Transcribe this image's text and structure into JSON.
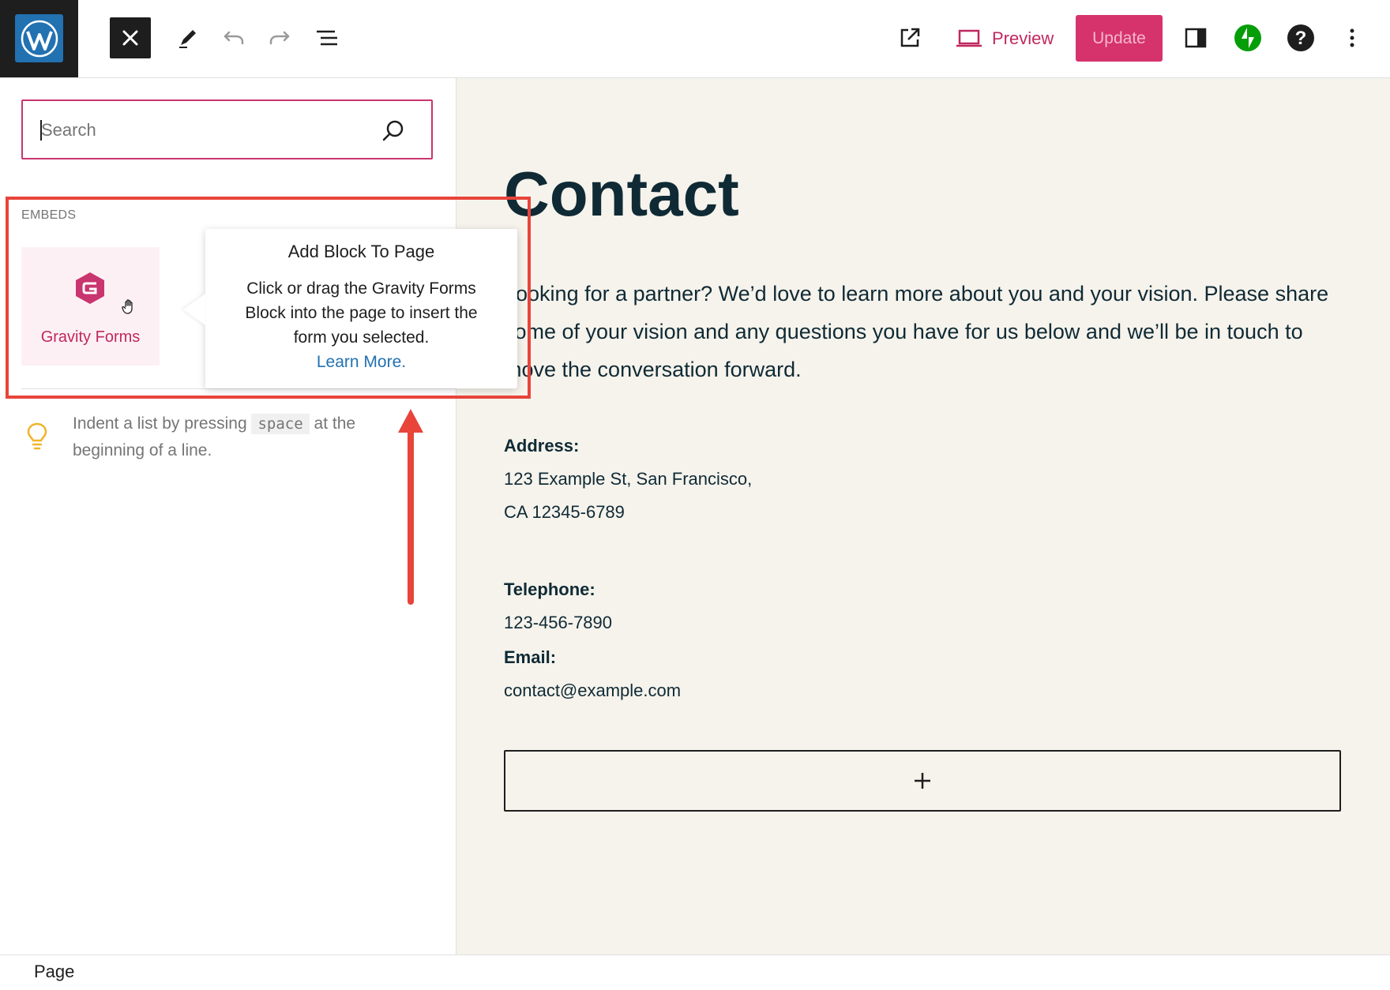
{
  "toolbar": {
    "preview_label": "Preview",
    "update_label": "Update"
  },
  "sidebar": {
    "search_placeholder": "Search",
    "section_label": "EMBEDS",
    "block_label": "Gravity Forms",
    "tip_text_before": "Indent a list by pressing",
    "tip_key": "space",
    "tip_text_after": "at the beginning of a line."
  },
  "popover": {
    "title": "Add Block To Page",
    "body": "Click or drag the Gravity Forms Block into the page to insert the form you selected.",
    "link": "Learn More."
  },
  "canvas": {
    "heading": "Contact",
    "intro": "Looking for a partner? We’d love to learn more about you and your vision. Please share some of your vision and any questions you have for us below and we’ll be in touch to move the conversation forward.",
    "address_label": "Address:",
    "address_line1": "123 Example St, San Francisco,",
    "address_line2": "CA 12345-6789",
    "telephone_label": "Telephone:",
    "telephone_value": "123-456-7890",
    "email_label": "Email:",
    "email_value": "contact@example.com"
  },
  "footer": {
    "breadcrumb": "Page"
  },
  "colors": {
    "accent": "#d6336c",
    "annotation": "#e8443a",
    "canvas_bg": "#f6f3ec",
    "text_dark": "#0f2a35",
    "link": "#2271b1",
    "jetpack": "#069e08"
  },
  "icons": [
    "wordpress-logo-icon",
    "close-icon",
    "pencil-icon",
    "undo-icon",
    "redo-icon",
    "list-view-icon",
    "external-link-icon",
    "laptop-icon",
    "sidebar-settings-icon",
    "jetpack-icon",
    "help-icon",
    "more-vertical-icon",
    "search-icon",
    "gravity-forms-icon",
    "hand-cursor-icon",
    "lightbulb-icon",
    "plus-icon",
    "red-arrow-up-icon"
  ]
}
